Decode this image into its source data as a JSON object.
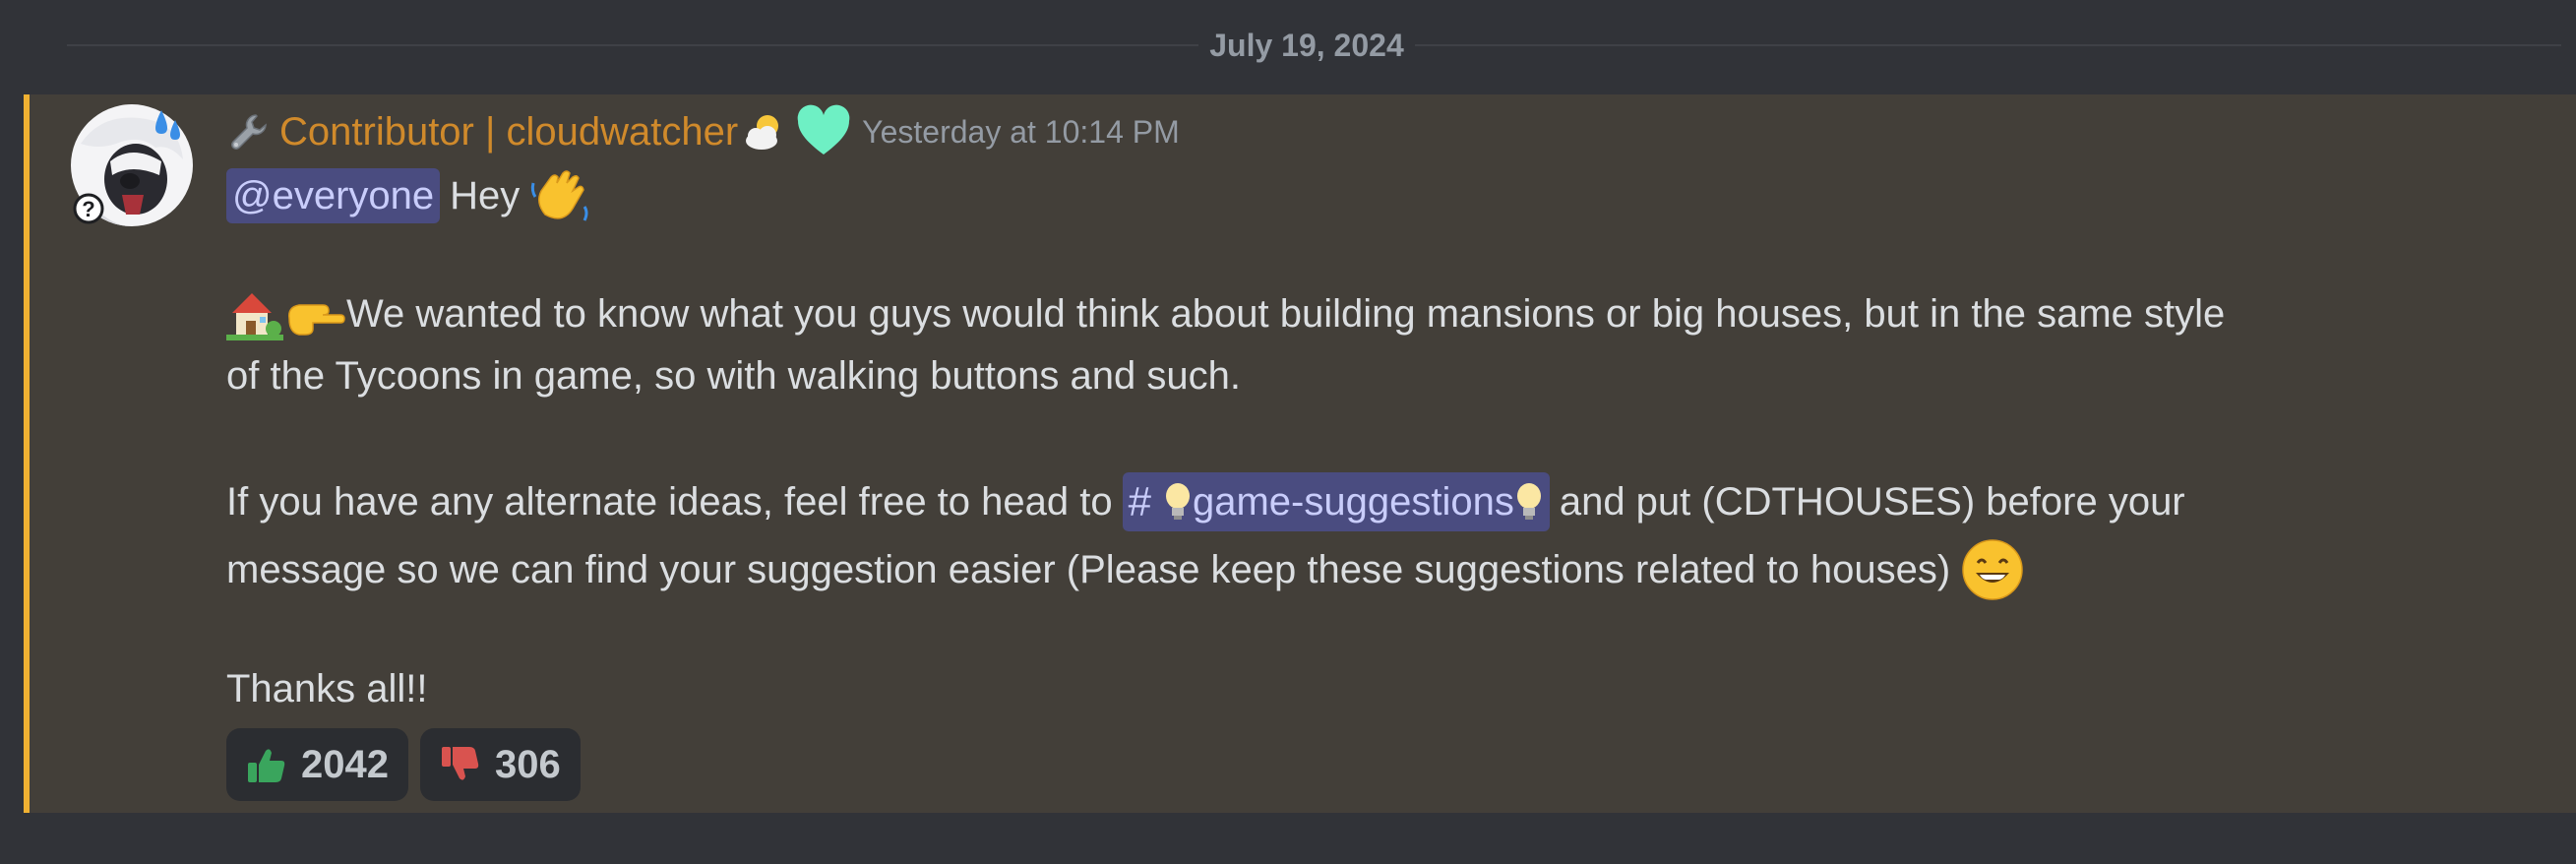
{
  "divider": {
    "date": "July 19, 2024"
  },
  "message": {
    "author": {
      "role_icon": "wrench-icon",
      "name": "Contributor | cloudwatcher",
      "name_color": "#d08a2b",
      "status_emoji": "sun-behind-cloud-icon",
      "badge": "green-heart-icon"
    },
    "timestamp": "Yesterday at 10:14 PM",
    "highlight_color": "#f0b132",
    "lines": {
      "l1_mention": "@everyone",
      "l1_text": "Hey",
      "l2_text": "We wanted to know what you guys would think about building mansions or big houses, but in the same style",
      "l3_text": "of the Tycoons in game, so with walking buttons and such.",
      "l4_text_a": "If you have any alternate ideas, feel free to head to",
      "l4_channel": "game-suggestions",
      "l4_text_b": "and put (CDTHOUSES) before your",
      "l5_text": "message so we can find your suggestion easier (Please keep these suggestions related to houses)",
      "l6_text": "Thanks all!!"
    },
    "reactions": [
      {
        "emoji": "thumbs-up-icon",
        "count": "2042"
      },
      {
        "emoji": "thumbs-down-icon",
        "count": "306"
      }
    ]
  }
}
